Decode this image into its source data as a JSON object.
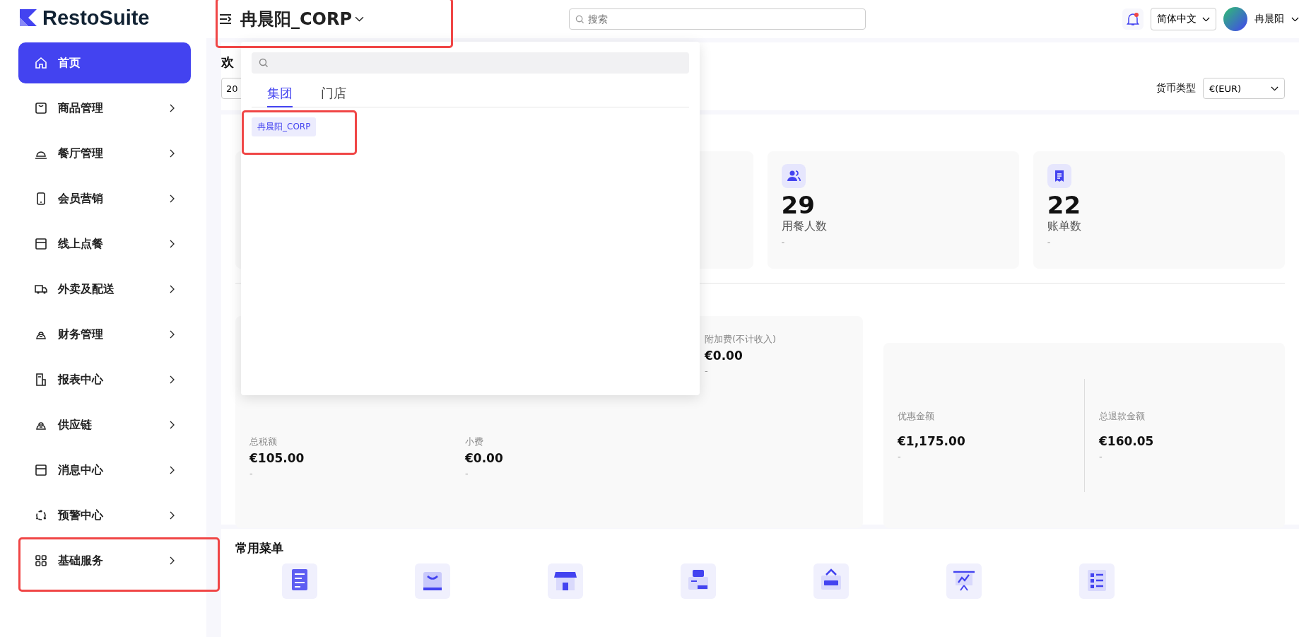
{
  "logo": "RestoSuite",
  "sidebar": {
    "items": [
      {
        "label": "首页",
        "selected": true,
        "expandable": false
      },
      {
        "label": "商品管理",
        "selected": false,
        "expandable": true
      },
      {
        "label": "餐厅管理",
        "selected": false,
        "expandable": true
      },
      {
        "label": "会员营销",
        "selected": false,
        "expandable": true
      },
      {
        "label": "线上点餐",
        "selected": false,
        "expandable": true
      },
      {
        "label": "外卖及配送",
        "selected": false,
        "expandable": true
      },
      {
        "label": "财务管理",
        "selected": false,
        "expandable": true
      },
      {
        "label": "报表中心",
        "selected": false,
        "expandable": true
      },
      {
        "label": "供应链",
        "selected": false,
        "expandable": true
      },
      {
        "label": "消息中心",
        "selected": false,
        "expandable": true
      },
      {
        "label": "预警中心",
        "selected": false,
        "expandable": true
      },
      {
        "label": "基础服务",
        "selected": false,
        "expandable": true
      }
    ]
  },
  "header": {
    "title": "冉晨阳_CORP",
    "search_placeholder": "搜索",
    "notification_dot": true,
    "language": "简体中文",
    "user": "冉晨阳"
  },
  "welcome": {
    "title": "欢",
    "date": "20",
    "currency_label": "货币类型",
    "currency": "€(EUR)"
  },
  "stats": [
    {
      "value": "29",
      "label": "用餐人数",
      "change": "-"
    },
    {
      "value": "22",
      "label": "账单数",
      "change": "-"
    }
  ],
  "revenue": {
    "row_1": [
      {
        "label": "附加费(不计收入)",
        "value": "€0.00",
        "change": "-"
      }
    ],
    "row_2": [
      {
        "label": "总税额",
        "value": "€105.00",
        "change": "-"
      },
      {
        "label": "小费",
        "value": "€0.00",
        "change": "-"
      }
    ],
    "discounts": [
      {
        "label": "优惠金额",
        "value": "€1,175.00",
        "change": "-"
      },
      {
        "label": "总退款金额",
        "value": "€160.05",
        "change": "-"
      }
    ]
  },
  "shortcuts": {
    "title": "常用菜单"
  },
  "org_picker": {
    "tabs": [
      {
        "label": "集团",
        "selected": true
      },
      {
        "label": "门店",
        "selected": false
      }
    ],
    "options": [
      {
        "label": "冉晨阳_CORP",
        "selected": true
      }
    ]
  }
}
